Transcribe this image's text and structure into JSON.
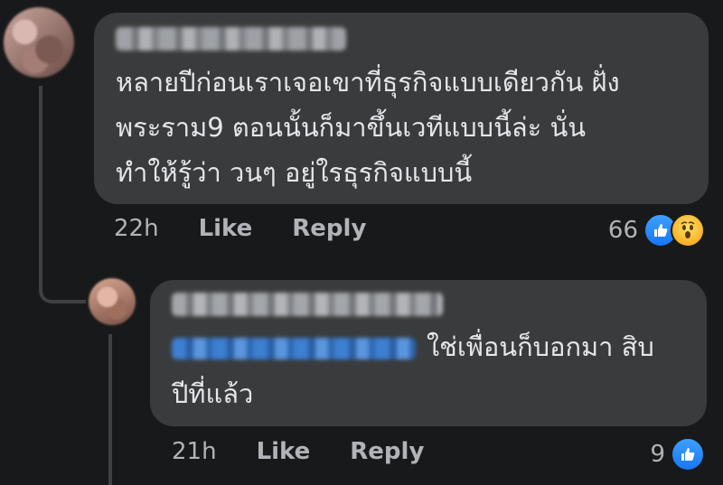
{
  "comment": {
    "text": "หลายปีก่อนเราเจอเขาที่ธุรกิจแบบเดียวกัน ฝั่ง\nพระราม9 ตอนนั้นก็มาขึ้นเวทีแบบนี้ล่ะ นั่น\nทำให้รู้ว่า วนๆ อยู่ใรธุรกิจแบบนี้",
    "time": "22h",
    "like_label": "Like",
    "reply_label": "Reply",
    "reaction_count": "66",
    "reaction_icons": [
      "like-icon",
      "wow-icon"
    ]
  },
  "reply": {
    "text": "ใช่เพื่อนก็บอกมา สิบ\nปีที่แล้ว",
    "time": "21h",
    "like_label": "Like",
    "reply_label": "Reply",
    "reaction_count": "9",
    "reaction_icons": [
      "like-icon"
    ]
  },
  "colors": {
    "background": "#18191a",
    "bubble": "#3a3b3c",
    "text": "#e4e6eb",
    "secondary_text": "#b0b3b8",
    "like_blue": "#1877f2",
    "wow_yellow": "#f7b125"
  }
}
